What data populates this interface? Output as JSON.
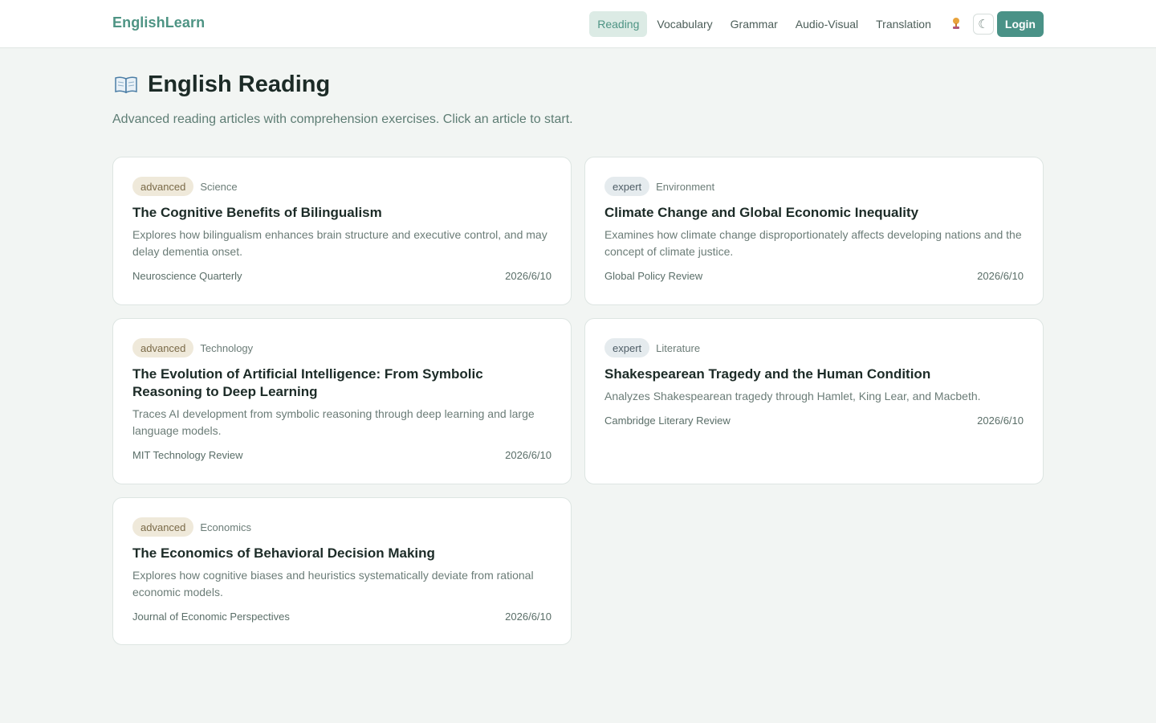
{
  "header": {
    "brand": "EnglishLearn",
    "nav": [
      "Reading",
      "Vocabulary",
      "Grammar",
      "Audio-Visual",
      "Translation"
    ],
    "active_nav": "Reading",
    "trophy_icon": "trophy-icon",
    "theme_toggle": "☾",
    "login_label": "Login"
  },
  "page": {
    "title": "English Reading",
    "subtitle": "Advanced reading articles with comprehension exercises. Click an article to start."
  },
  "articles": [
    {
      "level": "advanced",
      "category": "Science",
      "title": "The Cognitive Benefits of Bilingualism",
      "description": "Explores how bilingualism enhances brain structure and executive control, and may delay dementia onset.",
      "source": "Neuroscience Quarterly",
      "date": "2026/6/10"
    },
    {
      "level": "expert",
      "category": "Environment",
      "title": "Climate Change and Global Economic Inequality",
      "description": "Examines how climate change disproportionately affects developing nations and the concept of climate justice.",
      "source": "Global Policy Review",
      "date": "2026/6/10"
    },
    {
      "level": "advanced",
      "category": "Technology",
      "title": "The Evolution of Artificial Intelligence: From Symbolic Reasoning to Deep Learning",
      "description": "Traces AI development from symbolic reasoning through deep learning and large language models.",
      "source": "MIT Technology Review",
      "date": "2026/6/10"
    },
    {
      "level": "expert",
      "category": "Literature",
      "title": "Shakespearean Tragedy and the Human Condition",
      "description": "Analyzes Shakespearean tragedy through Hamlet, King Lear, and Macbeth.",
      "source": "Cambridge Literary Review",
      "date": "2026/6/10"
    },
    {
      "level": "advanced",
      "category": "Economics",
      "title": "The Economics of Behavioral Decision Making",
      "description": "Explores how cognitive biases and heuristics systematically deviate from rational economic models.",
      "source": "Journal of Economic Perspectives",
      "date": "2026/6/10"
    }
  ],
  "colors": {
    "accent": "#4e9484",
    "advanced_badge": "#efe9da",
    "expert_badge": "#e5ebee"
  }
}
